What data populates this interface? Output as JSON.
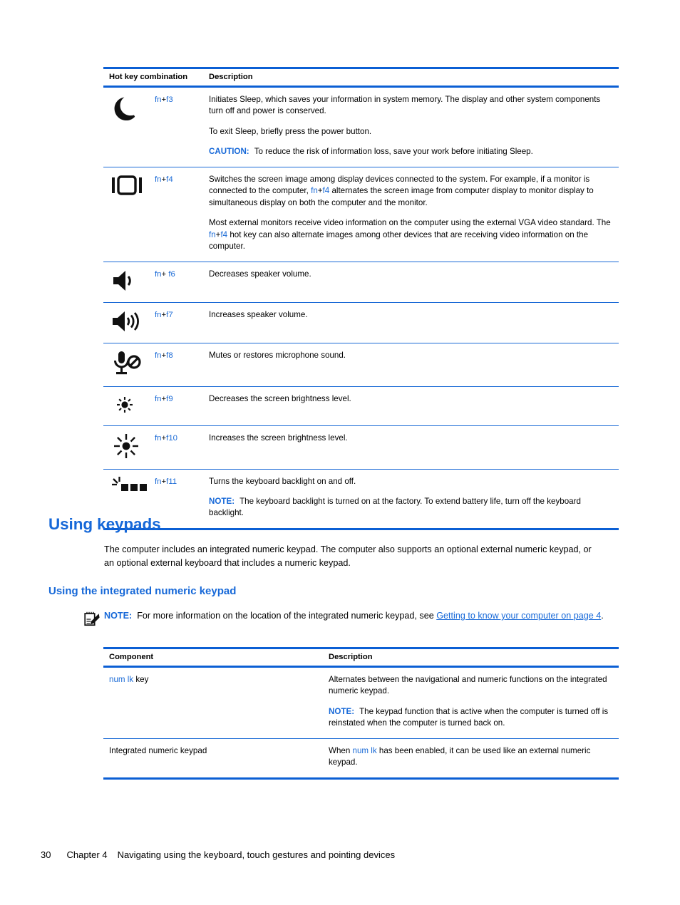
{
  "hotkey_table": {
    "headers": [
      "Hot key combination",
      "Description"
    ],
    "rows": [
      {
        "icon": "moon-icon",
        "combo_fn": "fn",
        "combo_plus": "+",
        "combo_key": "f3",
        "paragraphs": [
          "Initiates Sleep, which saves your information in system memory. The display and other system components turn off and power is conserved.",
          "To exit Sleep, briefly press the power button."
        ],
        "callout": {
          "label": "CAUTION:",
          "text": "To reduce the risk of information loss, save your work before initiating Sleep."
        }
      },
      {
        "icon": "display-switch-icon",
        "combo_fn": "fn",
        "combo_plus": "+",
        "combo_key": "f4",
        "paragraphs": [
          "Switches the screen image among display devices connected to the system. For example, if a monitor is connected to the computer, fn+f4 alternates the screen image from computer display to monitor display to simultaneous display on both the computer and the monitor.",
          "Most external monitors receive video information on the computer using the external VGA video standard. The fn+f4 hot key can also alternate images among other devices that are receiving video information on the computer."
        ]
      },
      {
        "icon": "volume-down-icon",
        "combo_fn": "fn",
        "combo_plus": "+ ",
        "combo_key": "f6",
        "paragraphs": [
          "Decreases speaker volume."
        ]
      },
      {
        "icon": "volume-up-icon",
        "combo_fn": "fn",
        "combo_plus": "+",
        "combo_key": "f7",
        "paragraphs": [
          "Increases speaker volume."
        ]
      },
      {
        "icon": "microphone-mute-icon",
        "combo_fn": "fn",
        "combo_plus": "+",
        "combo_key": "f8",
        "paragraphs": [
          "Mutes or restores microphone sound."
        ]
      },
      {
        "icon": "brightness-down-icon",
        "combo_fn": "fn",
        "combo_plus": "+",
        "combo_key": "f9",
        "paragraphs": [
          "Decreases the screen brightness level."
        ]
      },
      {
        "icon": "brightness-up-icon",
        "combo_fn": "fn",
        "combo_plus": "+",
        "combo_key": "f10",
        "paragraphs": [
          "Increases the screen brightness level."
        ]
      },
      {
        "icon": "keyboard-backlight-icon",
        "combo_fn": "fn",
        "combo_plus": "+",
        "combo_key": "f11",
        "paragraphs": [
          "Turns the keyboard backlight on and off."
        ],
        "callout": {
          "label": "NOTE:",
          "text": "The keyboard backlight is turned on at the factory. To extend battery life, turn off the keyboard backlight."
        }
      }
    ]
  },
  "section": {
    "heading": "Using keypads",
    "intro": "The computer includes an integrated numeric keypad. The computer also supports an optional external numeric keypad, or an optional external keyboard that includes a numeric keypad.",
    "subheading": "Using the integrated numeric keypad",
    "note": {
      "icon": "note-pad-pencil-icon",
      "label": "NOTE:",
      "text_before_link": "For more information on the location of the integrated numeric keypad, see ",
      "link_text": "Getting to know your computer on page 4",
      "text_after_link": "."
    }
  },
  "keypad_table": {
    "headers": [
      "Component",
      "Description"
    ],
    "rows": [
      {
        "component_link": "num lk",
        "component_rest": " key",
        "paragraphs": [
          "Alternates between the navigational and numeric functions on the integrated numeric keypad."
        ],
        "callout": {
          "label": "NOTE:",
          "text": "The keypad function that is active when the computer is turned off is reinstated when the computer is turned back on."
        }
      },
      {
        "component_link": "",
        "component_rest": "Integrated numeric keypad",
        "desc_before": "When ",
        "desc_link": "num lk",
        "desc_after": " has been enabled, it can be used like an external numeric keypad."
      }
    ]
  },
  "footer": {
    "page_number": "30",
    "chapter": "Chapter 4",
    "title": "Navigating using the keyboard, touch gestures and pointing devices"
  },
  "colors": {
    "accent_blue": "#1668d8",
    "rule_blue": "#0b5fd4",
    "link_blue": "#1668d8",
    "text_black": "#000000"
  }
}
